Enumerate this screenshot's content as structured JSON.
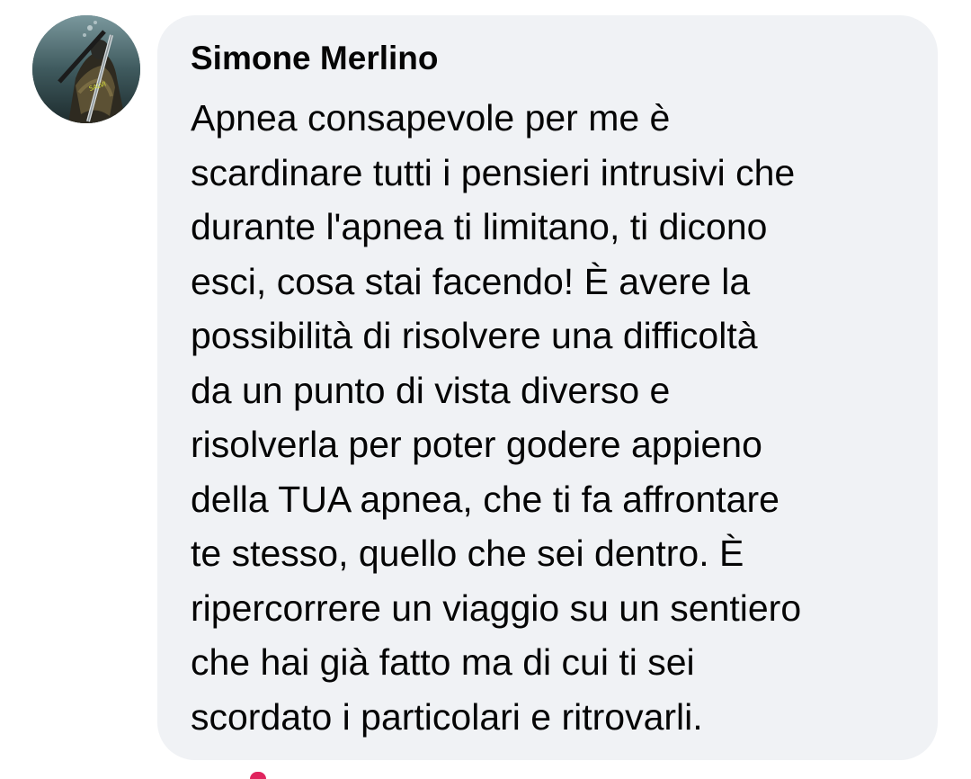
{
  "comment": {
    "author": "Simone Merlino",
    "lines": [
      "Apnea consapevole per me è",
      "scardinare tutti i pensieri intrusivi che",
      "durante l'apnea ti limitano, ti dicono",
      "esci, cosa stai facendo! È avere la",
      "possibilità di risolvere una difficoltà",
      "da un punto di vista diverso e",
      "risolverla per poter godere appieno",
      "della TUA apnea, che ti fa affrontare",
      "te stesso, quello che sei dentro. È",
      "ripercorrere un viaggio su un sentiero",
      "che hai già fatto ma di cui ti sei",
      "scordato i particolari e ritrovarli."
    ],
    "bubble_color": "#f0f2f5",
    "text_color": "#050505"
  }
}
